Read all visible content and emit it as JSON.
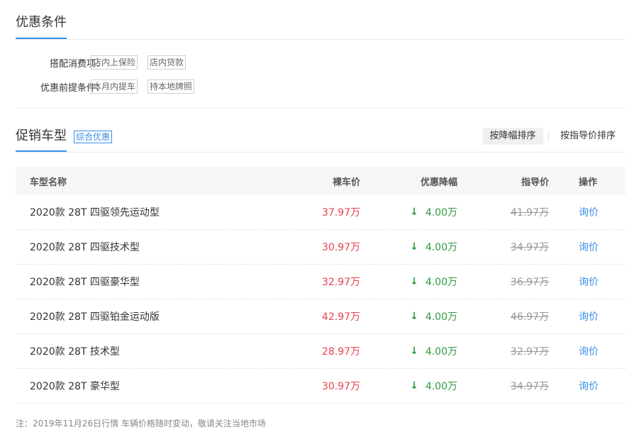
{
  "conditions": {
    "title": "优惠条件",
    "rows": [
      {
        "label": "搭配消费项：",
        "tags": [
          "店内上保险",
          "店内贷款"
        ]
      },
      {
        "label": "优惠前提条件：",
        "tags": [
          "本月内提车",
          "持本地牌照"
        ]
      }
    ]
  },
  "promo": {
    "title": "促销车型",
    "badge": "综合优惠",
    "sort_options": [
      "按降幅排序",
      "按指导价排序"
    ],
    "active_sort": "按降幅排序"
  },
  "table": {
    "headers": [
      "车型名称",
      "裸车价",
      "优惠降幅",
      "指导价",
      "操作"
    ],
    "rows": [
      {
        "name": "2020款 28T 四驱领先运动型",
        "price": "37.97万",
        "drop": "4.00万",
        "guide": "41.97万",
        "action": "询价"
      },
      {
        "name": "2020款 28T 四驱技术型",
        "price": "30.97万",
        "drop": "4.00万",
        "guide": "34.97万",
        "action": "询价"
      },
      {
        "name": "2020款 28T 四驱豪华型",
        "price": "32.97万",
        "drop": "4.00万",
        "guide": "36.97万",
        "action": "询价"
      },
      {
        "name": "2020款 28T 四驱铂金运动版",
        "price": "42.97万",
        "drop": "4.00万",
        "guide": "46.97万",
        "action": "询价"
      },
      {
        "name": "2020款 28T 技术型",
        "price": "28.97万",
        "drop": "4.00万",
        "guide": "32.97万",
        "action": "询价"
      },
      {
        "name": "2020款 28T 豪华型",
        "price": "30.97万",
        "drop": "4.00万",
        "guide": "34.97万",
        "action": "询价"
      }
    ]
  },
  "note": "注：2019年11月26日行情 车辆价格随时变动，敬请关注当地市场",
  "colors": {
    "accent": "#3b8ee6",
    "price": "#e8424e",
    "drop": "#2f9a3f",
    "muted": "#999999"
  },
  "icons": {
    "drop_arrow": "arrow-down-icon"
  }
}
